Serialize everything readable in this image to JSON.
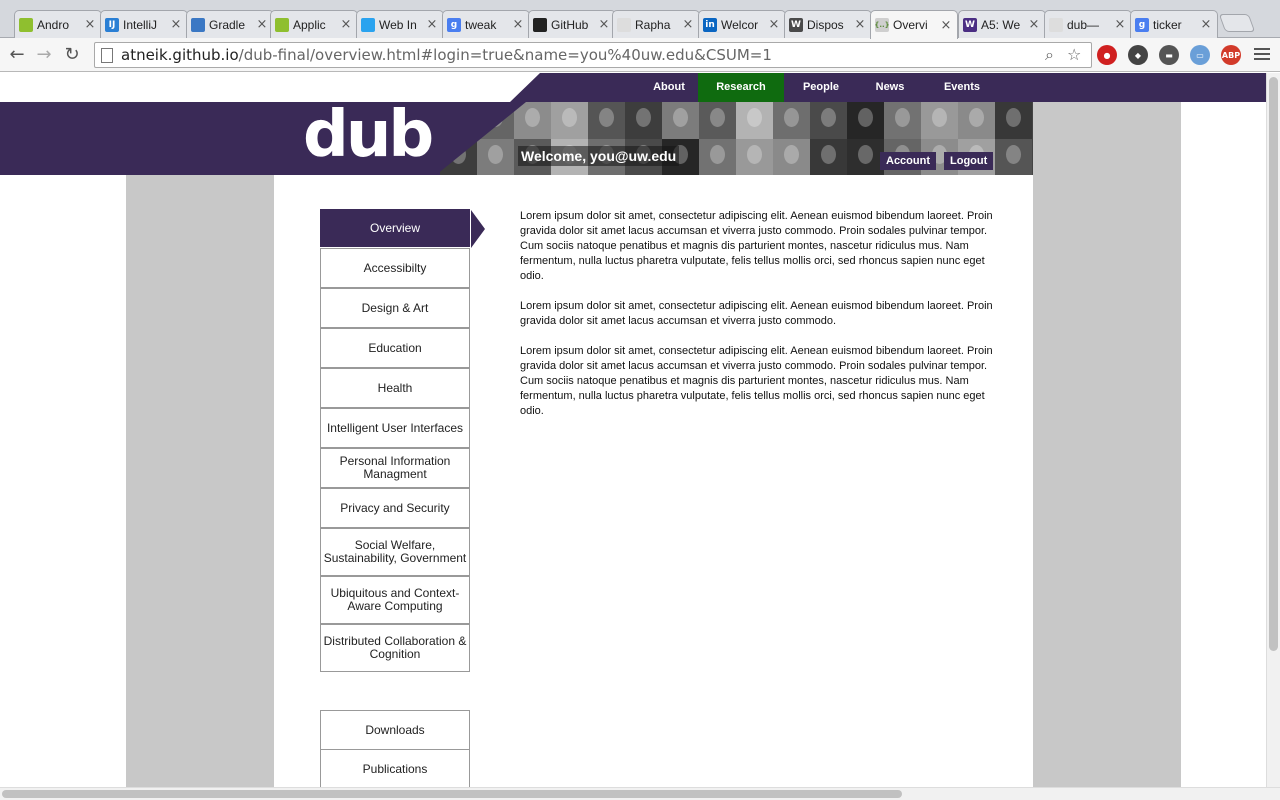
{
  "tabs": [
    {
      "title": "Andro",
      "icon": "android-icon",
      "color": "#8fbf2f",
      "glyph": ""
    },
    {
      "title": "IntelliJ",
      "icon": "intellij-icon",
      "color": "#2a7fd4",
      "glyph": "IJ"
    },
    {
      "title": "Gradle",
      "icon": "document-icon",
      "color": "#3b78c4",
      "glyph": ""
    },
    {
      "title": "Applic",
      "icon": "android-icon",
      "color": "#8fbf2f",
      "glyph": ""
    },
    {
      "title": "Web In",
      "icon": "twitter-icon",
      "color": "#2aa3ef",
      "glyph": ""
    },
    {
      "title": "tweak",
      "icon": "google-icon",
      "color": "#4a7ef0",
      "glyph": "g"
    },
    {
      "title": "GitHub",
      "icon": "github-icon",
      "color": "#222222",
      "glyph": ""
    },
    {
      "title": "Rapha",
      "icon": "page-icon",
      "color": "#dddddd",
      "glyph": ""
    },
    {
      "title": "Welcor",
      "icon": "linkedin-icon",
      "color": "#0a66c2",
      "glyph": "in"
    },
    {
      "title": "Dispos",
      "icon": "wordpress-icon",
      "color": "#4a4a4a",
      "glyph": "W"
    },
    {
      "title": "Overvi",
      "icon": "code-icon",
      "color": "#cfcfcf",
      "glyph": "{..}"
    },
    {
      "title": "A5: We",
      "icon": "uw-icon",
      "color": "#4b2e83",
      "glyph": "W"
    },
    {
      "title": "dub—",
      "icon": "page-icon",
      "color": "#dddddd",
      "glyph": ""
    },
    {
      "title": "ticker",
      "icon": "google-icon",
      "color": "#4a7ef0",
      "glyph": "g"
    }
  ],
  "active_tab": 10,
  "address": {
    "host": "atneik.github.io",
    "path": "/dub-final/overview.html#login=true&name=you%40uw.edu&CSUM=1"
  },
  "extensions": [
    {
      "name": "stop-extension-icon",
      "color": "#d02020",
      "glyph": "●"
    },
    {
      "name": "octocat-extension-icon",
      "color": "#444444",
      "glyph": "◆"
    },
    {
      "name": "mask-extension-icon",
      "color": "#555555",
      "glyph": "▬"
    },
    {
      "name": "window-extension-icon",
      "color": "#6a9fd8",
      "glyph": "▭"
    },
    {
      "name": "adblock-extension-icon",
      "color": "#d23a2a",
      "glyph": "ABP"
    }
  ],
  "nav": {
    "items": [
      "About",
      "Research",
      "People",
      "News",
      "Events"
    ],
    "active": "Research"
  },
  "header": {
    "logo": "dub",
    "welcome": "Welcome,  you@uw.edu",
    "account": "Account",
    "logout": "Logout"
  },
  "sidebar": {
    "items": [
      "Overview",
      "Accessibilty",
      "Design & Art",
      "Education",
      "Health",
      "Intelligent User Interfaces",
      "Personal Information Managment",
      "Privacy and Security",
      "Social Welfare, Sustainability, Government",
      "Ubiquitous and Context-Aware Computing",
      "Distributed Collaboration & Cognition"
    ],
    "secondary": [
      "Downloads",
      "Publications"
    ],
    "active": "Overview"
  },
  "content": {
    "paragraphs": [
      "Lorem ipsum dolor sit amet, consectetur adipiscing elit. Aenean euismod bibendum laoreet. Proin gravida dolor sit amet lacus accumsan et viverra justo commodo. Proin sodales pulvinar tempor. Cum sociis natoque penatibus et magnis dis parturient montes, nascetur ridiculus mus. Nam fermentum, nulla luctus pharetra vulputate, felis tellus mollis orci, sed rhoncus sapien nunc eget odio.",
      "Lorem ipsum dolor sit amet, consectetur adipiscing elit. Aenean euismod bibendum laoreet. Proin gravida dolor sit amet lacus accumsan et viverra justo commodo.",
      "Lorem ipsum dolor sit amet, consectetur adipiscing elit. Aenean euismod bibendum laoreet. Proin gravida dolor sit amet lacus accumsan et viverra justo commodo. Proin sodales pulvinar tempor. Cum sociis natoque penatibus et magnis dis parturient montes, nascetur ridiculus mus. Nam fermentum, nulla luctus pharetra vulputate, felis tellus mollis orci, sed rhoncus sapien nunc eget odio."
    ]
  },
  "colors": {
    "brand_purple": "#3a2a57",
    "active_green": "#0f6b0f",
    "side_gray": "#c8c8c8"
  }
}
